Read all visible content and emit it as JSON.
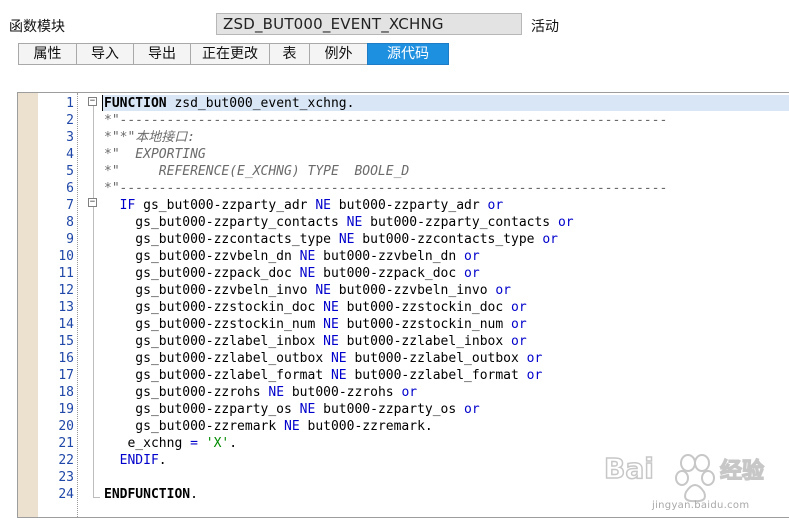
{
  "header": {
    "label": "函数模块",
    "name": "ZSD_BUT000_EVENT_XCHNG",
    "status": "活动"
  },
  "tabs": [
    {
      "label": "属性",
      "active": false
    },
    {
      "label": "导入",
      "active": false
    },
    {
      "label": "导出",
      "active": false
    },
    {
      "label": "正在更改",
      "active": false
    },
    {
      "label": "表",
      "active": false
    },
    {
      "label": "例外",
      "active": false
    },
    {
      "label": "源代码",
      "active": true
    }
  ],
  "code": {
    "lines": [
      {
        "n": "1",
        "tokens": [
          {
            "t": "FUNCTION",
            "c": "kw"
          },
          {
            "t": " zsd_but000_event_xchng.",
            "c": "id"
          }
        ]
      },
      {
        "n": "2",
        "tokens": [
          {
            "t": "*\"----------------------------------------------------------------------",
            "c": "cm"
          }
        ]
      },
      {
        "n": "3",
        "tokens": [
          {
            "t": "*\"*\"本地接口:",
            "c": "cm"
          }
        ]
      },
      {
        "n": "4",
        "tokens": [
          {
            "t": "*\"  EXPORTING",
            "c": "cm"
          }
        ]
      },
      {
        "n": "5",
        "tokens": [
          {
            "t": "*\"     REFERENCE(E_XCHNG) TYPE  BOOLE_D",
            "c": "cm"
          }
        ]
      },
      {
        "n": "6",
        "tokens": [
          {
            "t": "*\"----------------------------------------------------------------------",
            "c": "cm"
          }
        ]
      },
      {
        "n": "7",
        "tokens": [
          {
            "t": "  IF",
            "c": "op"
          },
          {
            "t": " gs_but000-zzparty_adr ",
            "c": "id"
          },
          {
            "t": "NE",
            "c": "op"
          },
          {
            "t": " but000-zzparty_adr ",
            "c": "id"
          },
          {
            "t": "or",
            "c": "op"
          }
        ]
      },
      {
        "n": "8",
        "tokens": [
          {
            "t": "    gs_but000-zzparty_contacts ",
            "c": "id"
          },
          {
            "t": "NE",
            "c": "op"
          },
          {
            "t": " but000-zzparty_contacts ",
            "c": "id"
          },
          {
            "t": "or",
            "c": "op"
          }
        ]
      },
      {
        "n": "9",
        "tokens": [
          {
            "t": "    gs_but000-zzcontacts_type ",
            "c": "id"
          },
          {
            "t": "NE",
            "c": "op"
          },
          {
            "t": " but000-zzcontacts_type ",
            "c": "id"
          },
          {
            "t": "or",
            "c": "op"
          }
        ]
      },
      {
        "n": "10",
        "tokens": [
          {
            "t": "    gs_but000-zzvbeln_dn ",
            "c": "id"
          },
          {
            "t": "NE",
            "c": "op"
          },
          {
            "t": " but000-zzvbeln_dn ",
            "c": "id"
          },
          {
            "t": "or",
            "c": "op"
          }
        ]
      },
      {
        "n": "11",
        "tokens": [
          {
            "t": "    gs_but000-zzpack_doc ",
            "c": "id"
          },
          {
            "t": "NE",
            "c": "op"
          },
          {
            "t": " but000-zzpack_doc ",
            "c": "id"
          },
          {
            "t": "or",
            "c": "op"
          }
        ]
      },
      {
        "n": "12",
        "tokens": [
          {
            "t": "    gs_but000-zzvbeln_invo ",
            "c": "id"
          },
          {
            "t": "NE",
            "c": "op"
          },
          {
            "t": " but000-zzvbeln_invo ",
            "c": "id"
          },
          {
            "t": "or",
            "c": "op"
          }
        ]
      },
      {
        "n": "13",
        "tokens": [
          {
            "t": "    gs_but000-zzstockin_doc ",
            "c": "id"
          },
          {
            "t": "NE",
            "c": "op"
          },
          {
            "t": " but000-zzstockin_doc ",
            "c": "id"
          },
          {
            "t": "or",
            "c": "op"
          }
        ]
      },
      {
        "n": "14",
        "tokens": [
          {
            "t": "    gs_but000-zzstockin_num ",
            "c": "id"
          },
          {
            "t": "NE",
            "c": "op"
          },
          {
            "t": " but000-zzstockin_num ",
            "c": "id"
          },
          {
            "t": "or",
            "c": "op"
          }
        ]
      },
      {
        "n": "15",
        "tokens": [
          {
            "t": "    gs_but000-zzlabel_inbox ",
            "c": "id"
          },
          {
            "t": "NE",
            "c": "op"
          },
          {
            "t": " but000-zzlabel_inbox ",
            "c": "id"
          },
          {
            "t": "or",
            "c": "op"
          }
        ]
      },
      {
        "n": "16",
        "tokens": [
          {
            "t": "    gs_but000-zzlabel_outbox ",
            "c": "id"
          },
          {
            "t": "NE",
            "c": "op"
          },
          {
            "t": " but000-zzlabel_outbox ",
            "c": "id"
          },
          {
            "t": "or",
            "c": "op"
          }
        ]
      },
      {
        "n": "17",
        "tokens": [
          {
            "t": "    gs_but000-zzlabel_format ",
            "c": "id"
          },
          {
            "t": "NE",
            "c": "op"
          },
          {
            "t": " but000-zzlabel_format ",
            "c": "id"
          },
          {
            "t": "or",
            "c": "op"
          }
        ]
      },
      {
        "n": "18",
        "tokens": [
          {
            "t": "    gs_but000-zzrohs ",
            "c": "id"
          },
          {
            "t": "NE",
            "c": "op"
          },
          {
            "t": " but000-zzrohs ",
            "c": "id"
          },
          {
            "t": "or",
            "c": "op"
          }
        ]
      },
      {
        "n": "19",
        "tokens": [
          {
            "t": "    gs_but000-zzparty_os ",
            "c": "id"
          },
          {
            "t": "NE",
            "c": "op"
          },
          {
            "t": " but000-zzparty_os ",
            "c": "id"
          },
          {
            "t": "or",
            "c": "op"
          }
        ]
      },
      {
        "n": "20",
        "tokens": [
          {
            "t": "    gs_but000-zzremark ",
            "c": "id"
          },
          {
            "t": "NE",
            "c": "op"
          },
          {
            "t": " but000-zzremark.",
            "c": "id"
          }
        ]
      },
      {
        "n": "21",
        "tokens": [
          {
            "t": "   e_xchng ",
            "c": "id"
          },
          {
            "t": "=",
            "c": "op"
          },
          {
            "t": " ",
            "c": "id"
          },
          {
            "t": "'X'",
            "c": "str"
          },
          {
            "t": ".",
            "c": "id"
          }
        ]
      },
      {
        "n": "22",
        "tokens": [
          {
            "t": "  ENDIF",
            "c": "op"
          },
          {
            "t": ".",
            "c": "id"
          }
        ]
      },
      {
        "n": "23",
        "tokens": []
      },
      {
        "n": "24",
        "tokens": [
          {
            "t": "ENDFUNCTION",
            "c": "kw"
          },
          {
            "t": ".",
            "c": "id"
          }
        ]
      }
    ]
  },
  "watermark": {
    "text": "Baidu经验",
    "url": "jingyan.baidu.com"
  }
}
